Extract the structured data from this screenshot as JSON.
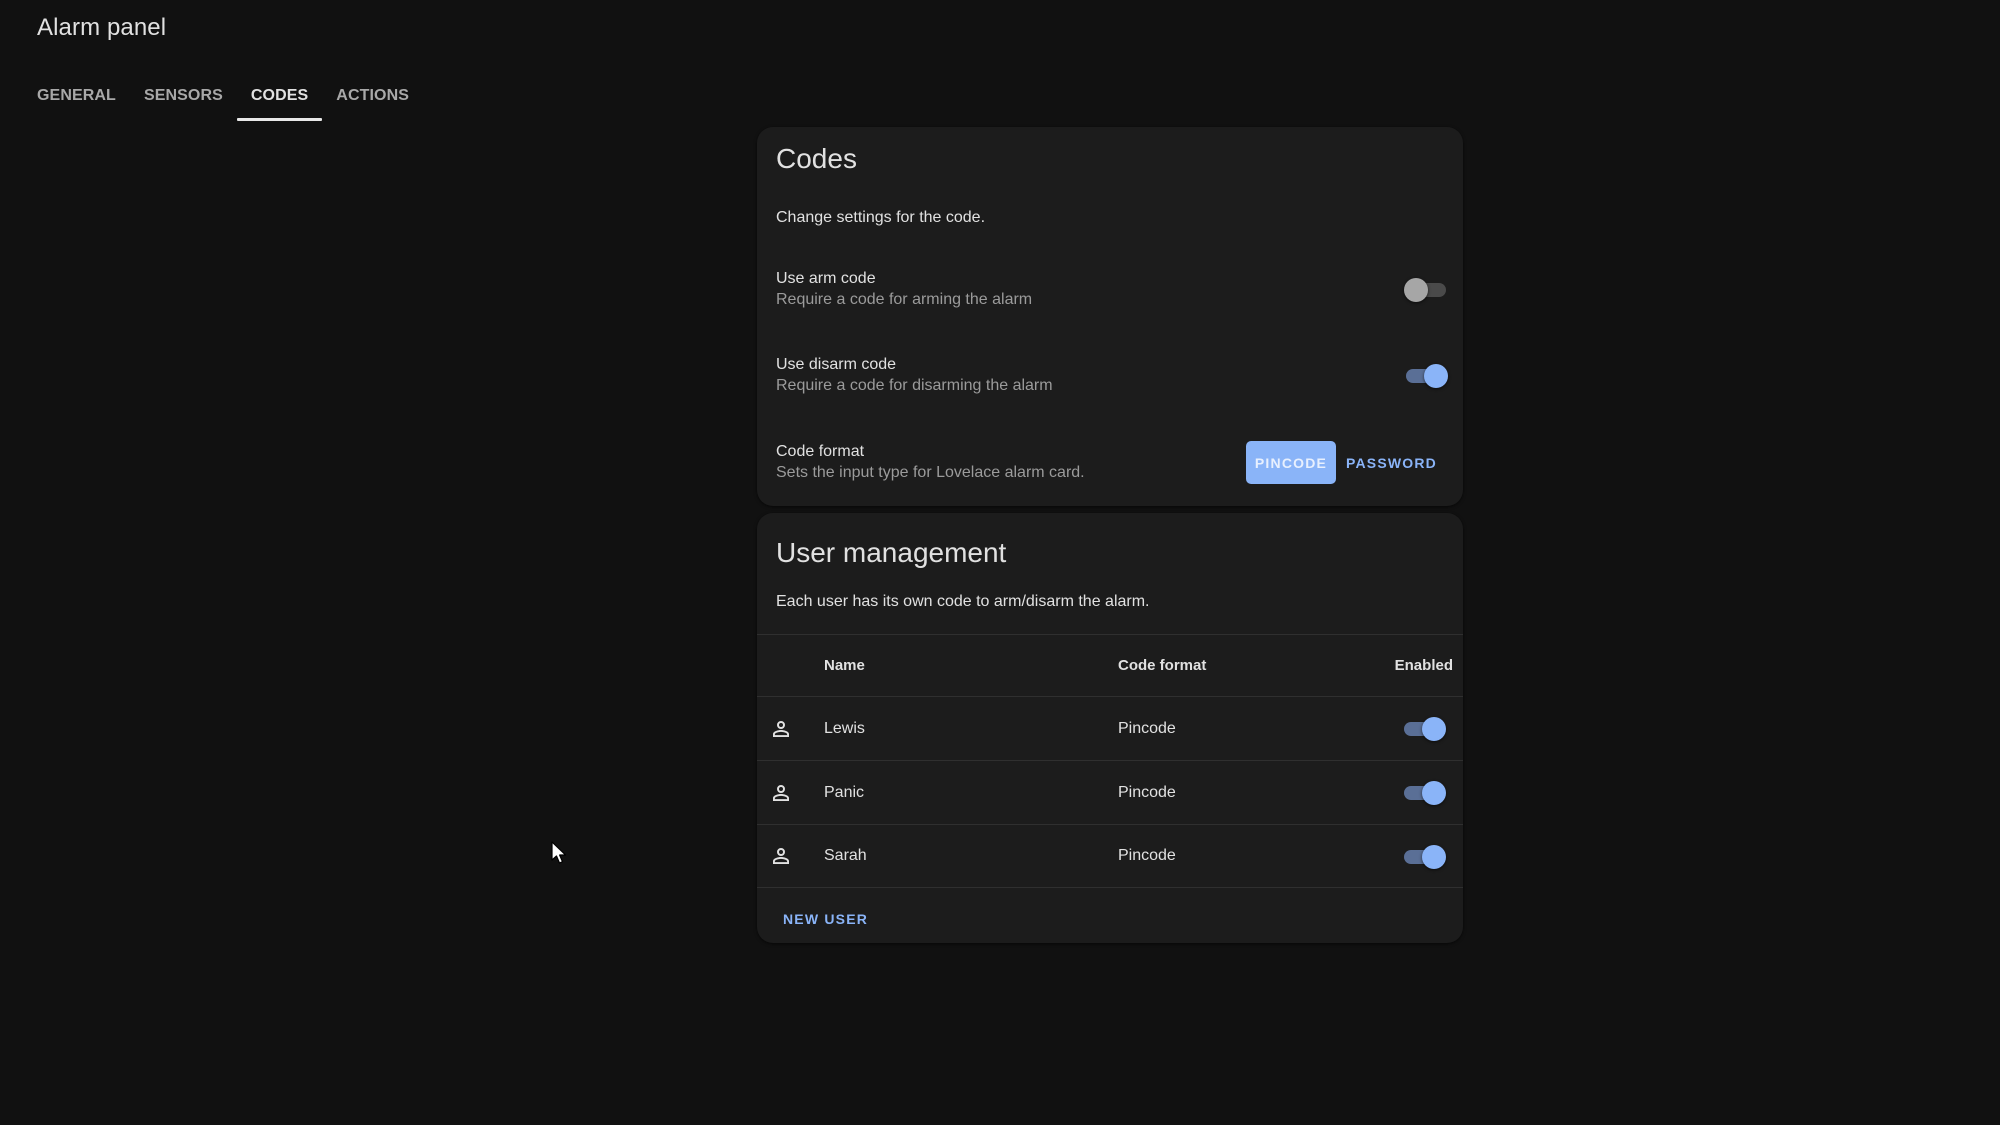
{
  "page": {
    "title": "Alarm panel",
    "tabs": [
      {
        "label": "General",
        "active": false
      },
      {
        "label": "Sensors",
        "active": false
      },
      {
        "label": "Codes",
        "active": true
      },
      {
        "label": "Actions",
        "active": false
      }
    ]
  },
  "codes_card": {
    "title": "Codes",
    "description": "Change settings for the code.",
    "settings": {
      "arm_code": {
        "label": "Use arm code",
        "sublabel": "Require a code for arming the alarm",
        "enabled": false
      },
      "disarm_code": {
        "label": "Use disarm code",
        "sublabel": "Require a code for disarming the alarm",
        "enabled": true
      },
      "code_format": {
        "label": "Code format",
        "sublabel": "Sets the input type for Lovelace alarm card.",
        "options": [
          "Pincode",
          "Password"
        ],
        "selected": "Pincode"
      }
    }
  },
  "users_card": {
    "title": "User management",
    "description": "Each user has its own code to arm/disarm the alarm.",
    "columns": [
      "Name",
      "Code format",
      "Enabled"
    ],
    "rows": [
      {
        "icon": "account-outline-icon",
        "name": "Lewis",
        "code_format": "Pincode",
        "enabled": true
      },
      {
        "icon": "account-outline-icon",
        "name": "Panic",
        "code_format": "Pincode",
        "enabled": true
      },
      {
        "icon": "account-outline-icon",
        "name": "Sarah",
        "code_format": "Pincode",
        "enabled": true
      }
    ],
    "new_user_label": "New user"
  },
  "colors": {
    "accent": "#8ab4f8",
    "background": "#111111",
    "card": "#1c1c1c"
  }
}
